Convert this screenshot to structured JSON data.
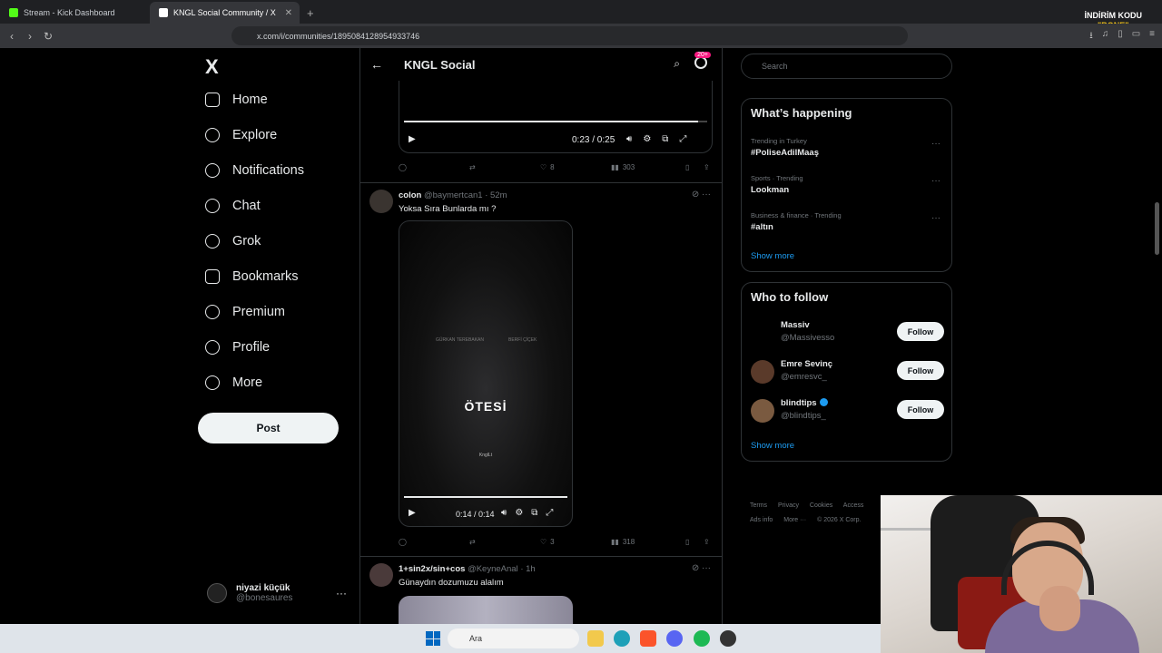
{
  "browser": {
    "tabs": [
      {
        "title": "Stream - Kick Dashboard",
        "favicon_color": "#53fc18"
      },
      {
        "title": "KNGL Social Community / X",
        "favicon_color": "#ffffff"
      }
    ],
    "url": "x.com/i/communities/1895084128954933746",
    "promo_line1": "İNDİRİM KODU",
    "promo_line2": "\"BONE\""
  },
  "nav": {
    "logo": "X",
    "items": [
      "Home",
      "Explore",
      "Notifications",
      "Chat",
      "Grok",
      "Bookmarks",
      "Premium",
      "Profile",
      "More"
    ],
    "post_label": "Post",
    "account_name": "niyazi küçük",
    "account_handle": "@bonesaures"
  },
  "timeline": {
    "header_title": "KNGL Social",
    "notif_badge": "20+",
    "video1": {
      "time": "0:23 / 0:25",
      "progress": 0.97
    },
    "tweet1_actions": {
      "likes": "8",
      "views": "303"
    },
    "tweet2": {
      "name": "colon",
      "handle": "@baymertcan1",
      "time": "52m",
      "text": "Yoksa Sıra Bunlarda mı ?",
      "video_title": "ÖTESİ",
      "video_sub": "KnglLt",
      "video_graffiti_left": "GÜRKAN TEREBAKAN",
      "video_graffiti_right": "BERFİ ÇİÇEK",
      "video_time": "0:14 / 0:14",
      "progress": 1.0,
      "likes": "3",
      "views": "318"
    },
    "tweet3": {
      "name": "1+sin2x/sin+cos",
      "handle": "@KeyneAnal",
      "time": "1h",
      "text": "Günaydın dozumuzu alalım"
    }
  },
  "sidebar": {
    "search_placeholder": "Search",
    "happening_title": "What’s happening",
    "trends": [
      {
        "category": "Trending in Turkey",
        "tag": "#PoliseAdilMaaş"
      },
      {
        "category": "Sports · Trending",
        "tag": "Lookman"
      },
      {
        "category": "Business & finance · Trending",
        "tag": "#altın"
      }
    ],
    "show_more": "Show more",
    "wtf_title": "Who to follow",
    "follows": [
      {
        "name": "Massiv",
        "handle": "@Massivesso",
        "button": "Follow"
      },
      {
        "name": "Emre Sevinç",
        "handle": "@emresvc_",
        "button": "Follow"
      },
      {
        "name": "blindtips",
        "handle": "@blindtips_",
        "button": "Follow"
      }
    ],
    "footer": [
      "Terms",
      "Privacy",
      "Cookies",
      "Access",
      "Ads info",
      "More ···",
      "© 2026 X Corp."
    ]
  },
  "taskbar": {
    "search_label": "Ara"
  }
}
